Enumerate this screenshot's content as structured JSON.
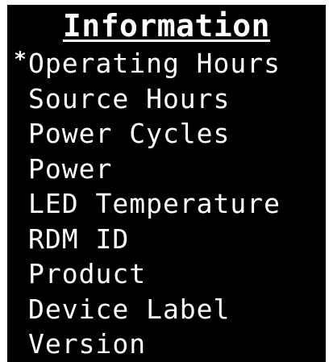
{
  "screen": {
    "title": "Information",
    "selection_marker": "*",
    "items": [
      {
        "label": "Operating Hours",
        "selected": true
      },
      {
        "label": "Source Hours",
        "selected": false
      },
      {
        "label": "Power Cycles",
        "selected": false
      },
      {
        "label": "Power",
        "selected": false
      },
      {
        "label": "LED Temperature",
        "selected": false
      },
      {
        "label": "RDM ID",
        "selected": false
      },
      {
        "label": "Product",
        "selected": false
      },
      {
        "label": "Device Label",
        "selected": false
      },
      {
        "label": "Version",
        "selected": false
      }
    ]
  }
}
